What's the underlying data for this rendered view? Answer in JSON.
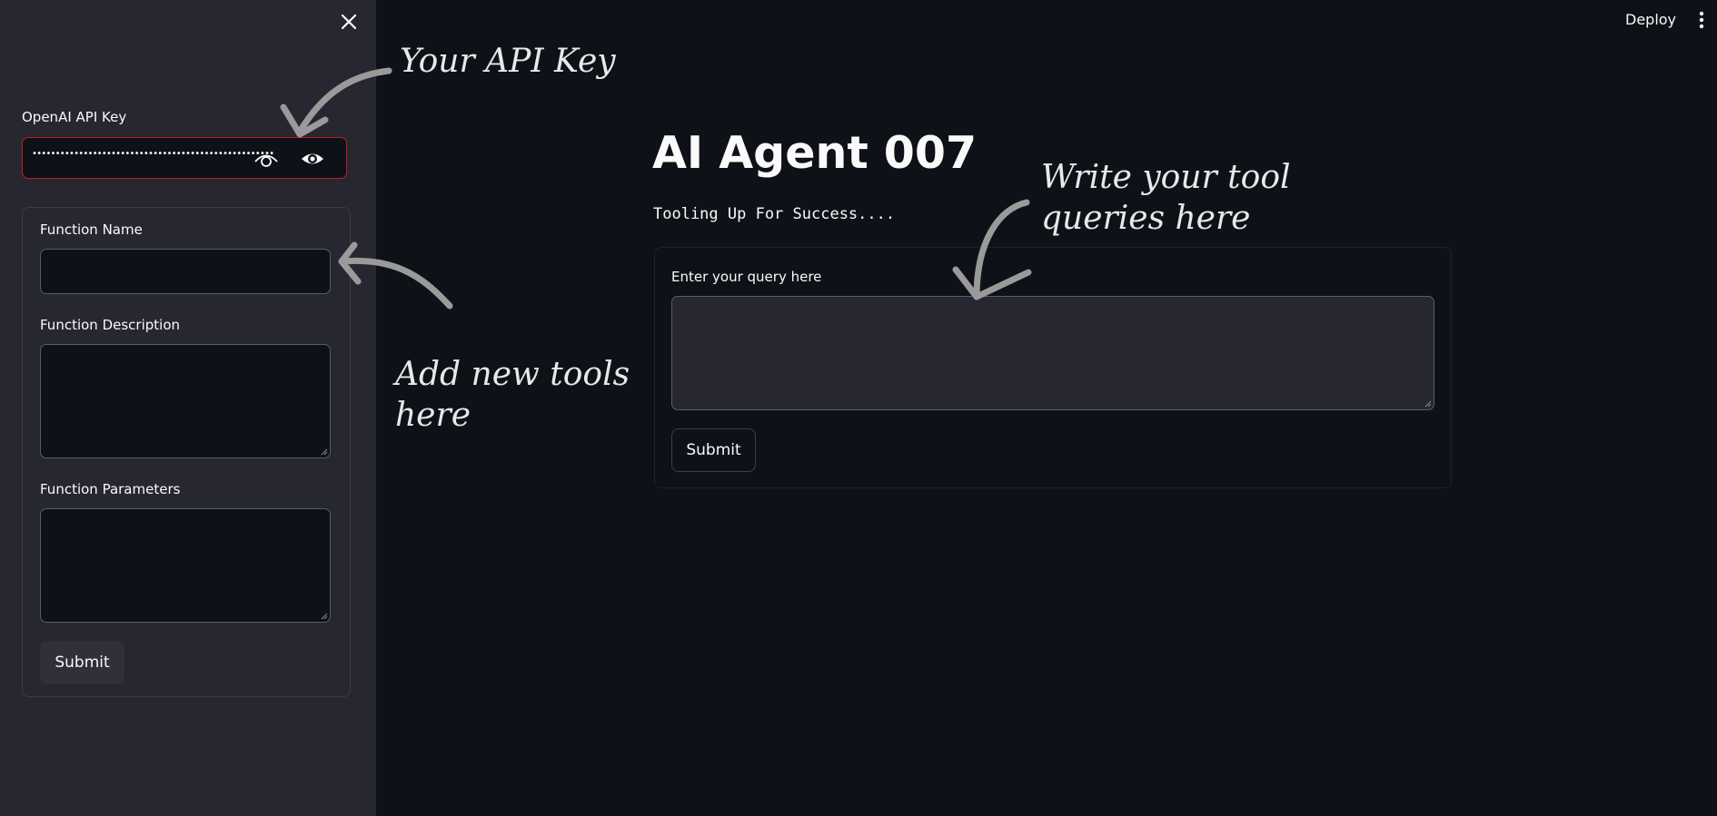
{
  "sidebar": {
    "api_key": {
      "label": "OpenAI API Key",
      "masked_value": "••••••••••••••••••••••••••••••••••••••••••••••••••••"
    },
    "form": {
      "function_name_label": "Function Name",
      "function_name_value": "",
      "function_description_label": "Function Description",
      "function_description_value": "",
      "function_parameters_label": "Function Parameters",
      "function_parameters_value": "",
      "submit_label": "Submit"
    }
  },
  "header": {
    "deploy_label": "Deploy"
  },
  "main": {
    "title": "AI Agent 007",
    "subtitle": "Tooling Up For Success....",
    "query_label": "Enter your query here",
    "query_value": "",
    "submit_label": "Submit"
  },
  "annotations": {
    "api_key_note": "Your API Key",
    "tools_note_line1": "Add new tools",
    "tools_note_line2": "here",
    "query_note_line1": "Write your tool",
    "query_note_line2": "queries here"
  },
  "icons": {
    "close": "close-icon",
    "password_reveal": "eye-outline-icon",
    "visibility_toggle": "eye-icon",
    "menu": "kebab-menu-icon",
    "arrow": "hand-drawn-arrow-icon"
  },
  "colors": {
    "background": "#0e1117",
    "sidebar": "#262730",
    "error_border": "#c21d1d",
    "text": "#fafafa"
  }
}
